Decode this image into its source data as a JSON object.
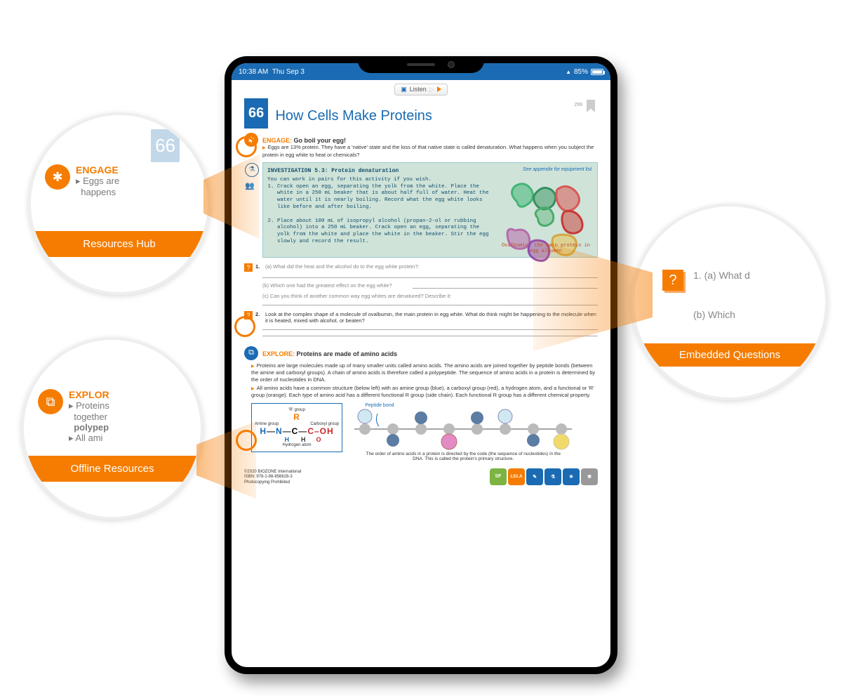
{
  "status": {
    "time": "10:38 AM",
    "date": "Thu Sep 3",
    "battery": "85%"
  },
  "listen": {
    "label": "Listen"
  },
  "page": {
    "number": "66",
    "title": "How Cells Make Proteins",
    "pagenum": "299",
    "engage": {
      "label": "ENGAGE:",
      "heading": "Go boil your egg!",
      "body": "Eggs are 13% protein. They have a 'native' state and the loss of that native state is called denaturation. What happens when you subject the protein in egg white to heat or chemicals?"
    },
    "investigation": {
      "title": "INVESTIGATION 5.3: Protein denaturation",
      "appendix": "See appendix for equipment list.",
      "intro": "You can work in pairs for this activity if you wish.",
      "step1": "Crack open an egg, separating the yolk from the white. Place the white in a 250 mL beaker that is about half full of water. Heat the water until it is nearly boiling. Record what the egg white looks like before and after boiling.",
      "step2": "Place about 100 mL of isopropyl alcohol (propan-2-ol or rubbing alcohol) into a 250 mL beaker. Crack open an egg, separating the yolk from the white and place the white in the beaker. Stir the egg slowly and record the result.",
      "caption": "Ovalbumin, the main protein in egg albumen"
    },
    "q1a": "(a) What did the heat and the alcohol do to the egg white protein?:",
    "q1b": "(b) Which one had the greatest effect on the egg white?",
    "q1c": "(c) Can you think of another common way egg whites are denatured? Describe it:",
    "q2": "Look at the complex shape of a molecule of ovalbumin, the main protein in egg white. What do think might be happening to the molecule when it is heated, mixed with alcohol, or beaten?",
    "explore": {
      "label": "EXPLORE:",
      "heading": "Proteins are made of amino acids",
      "p1": "Proteins are large molecules made up of many smaller units called amino acids. The amino acids are joined together by peptide bonds (between the amine and carboxyl groups). A chain of amino acids is therefore called a polypeptide.  The sequence of amino acids in a protein is determined by the order of nucleotides in DNA.",
      "p2": "All amino acids have a common structure (below left) with an amine group (blue), a carboxyl group (red), a hydrogen atom, and a functional or 'R' group (orange). Each type of amino acid has a different functional R group (side chain). Each functional R group has a different chemical property."
    },
    "amino": {
      "r": "'R' group",
      "amine": "Amine group",
      "carboxyl": "Carboxyl group",
      "hyd": "Hydrogen atom"
    },
    "peptide": {
      "label": "Peptide bond",
      "caption": "The order of amino acids in a protein is directed by the code (the sequence of nucleotides) in the DNA. This is called the protein's primary structure."
    },
    "copyright": {
      "l1": "©2020 BIOZONE International",
      "l2": "ISBN: 978-1-98-856628-3",
      "l3": "Photocopying Prohibited"
    },
    "tags": {
      "sf": "SF",
      "ls": "LS1.A"
    }
  },
  "callouts": {
    "c1": {
      "title": "Resources Hub",
      "head": "ENGAGE",
      "body1": "Eggs are",
      "body2": "happens",
      "num": "66"
    },
    "c2": {
      "title": "Offline Resources",
      "head": "EXPLOR",
      "body1": "Proteins",
      "body2": "together",
      "body3": "polypep",
      "body4": "All ami"
    },
    "c3": {
      "title": "Embedded Questions",
      "q1": "1.   (a) What d",
      "q2": "(b)  Which"
    }
  }
}
